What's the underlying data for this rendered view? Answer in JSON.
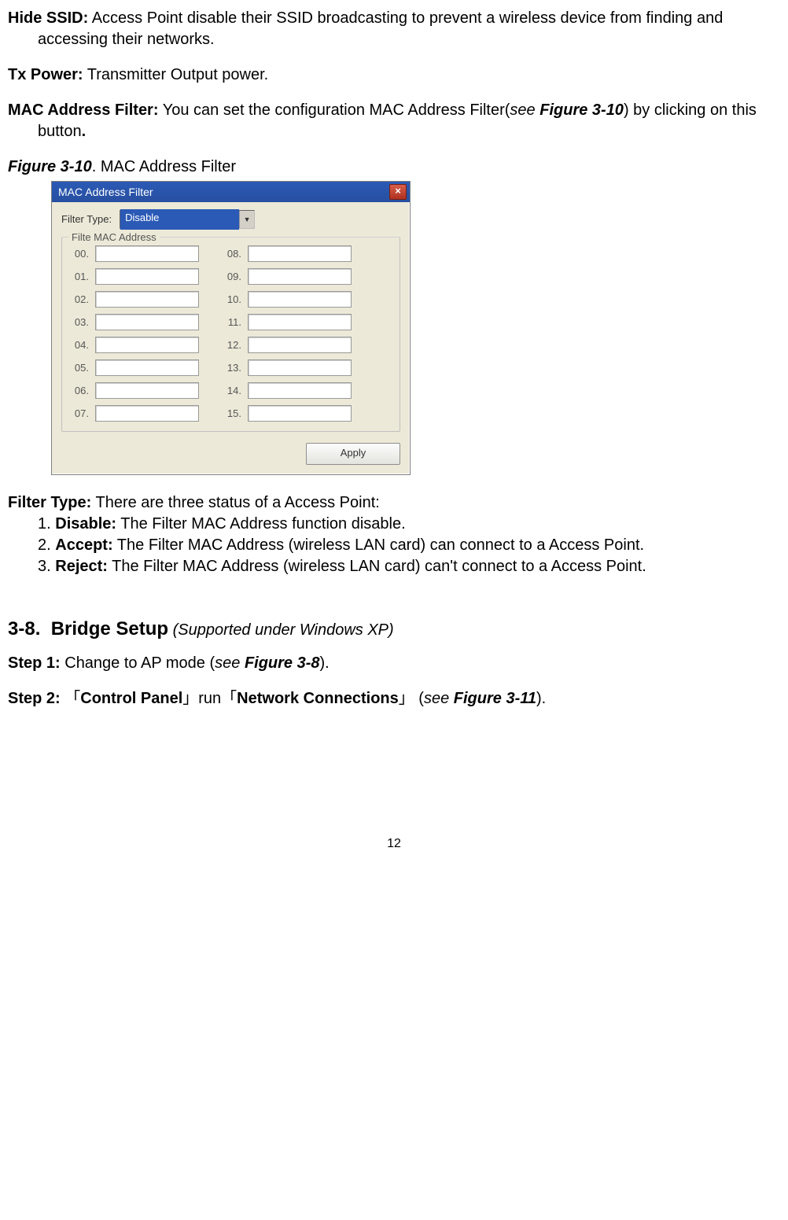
{
  "paragraphs": {
    "hide_ssid_label": "Hide SSID:",
    "hide_ssid_text": " Access Point disable their SSID broadcasting to prevent a wireless device from finding and accessing their networks.",
    "tx_power_label": "Tx Power:",
    "tx_power_text": " Transmitter Output power.",
    "mac_filter_label": "MAC Address Filter:",
    "mac_filter_text_a": " You can set the configuration MAC Address Filter(",
    "mac_filter_see": "see ",
    "mac_filter_ref": "Figure 3-10",
    "mac_filter_text_b": ") by clicking on this button",
    "mac_filter_period": "."
  },
  "figure": {
    "ref": "Figure 3-10",
    "caption_suffix": ".   MAC Address Filter"
  },
  "dialog": {
    "title": "MAC Address Filter",
    "close_glyph": "×",
    "filter_type_label": "Filter Type:",
    "filter_type_value": "Disable",
    "group_legend": "Filte MAC Address",
    "left_labels": [
      "00.",
      "01.",
      "02.",
      "03.",
      "04.",
      "05.",
      "06.",
      "07."
    ],
    "right_labels": [
      "08.",
      "09.",
      "10.",
      "11.",
      "12.",
      "13.",
      "14.",
      "15."
    ],
    "apply_label": "Apply"
  },
  "filter_type_section": {
    "header_label": "Filter Type:",
    "header_text": " There are three status of a Access Point:",
    "item1_prefix": "1. ",
    "item1_label": "Disable:",
    "item1_text": " The Filter MAC Address function disable.",
    "item2_prefix": "2. ",
    "item2_label": "Accept:",
    "item2_text": " The Filter MAC Address (wireless LAN card) can connect to a Access Point.",
    "item3_prefix": "3. ",
    "item3_label": "Reject:",
    "item3_text": " The Filter MAC Address (wireless LAN card) can't connect to a Access Point."
  },
  "section": {
    "number": "3-8.",
    "title": "Bridge Setup",
    "subtitle": " (Supported under Windows XP)"
  },
  "steps": {
    "step1_label": "Step 1:",
    "step1_text_a": " Change to AP mode (",
    "step1_see": "see ",
    "step1_ref": "Figure 3-8",
    "step1_text_b": ").",
    "step2_label": "Step 2:",
    "step2_text_a": "  「",
    "step2_cp": "Control Panel",
    "step2_mid": "」run「",
    "step2_nc": "Network Connections",
    "step2_text_b": "」 (",
    "step2_see": "see ",
    "step2_ref": "Figure 3-11",
    "step2_text_c": ")."
  },
  "page_number": "12"
}
